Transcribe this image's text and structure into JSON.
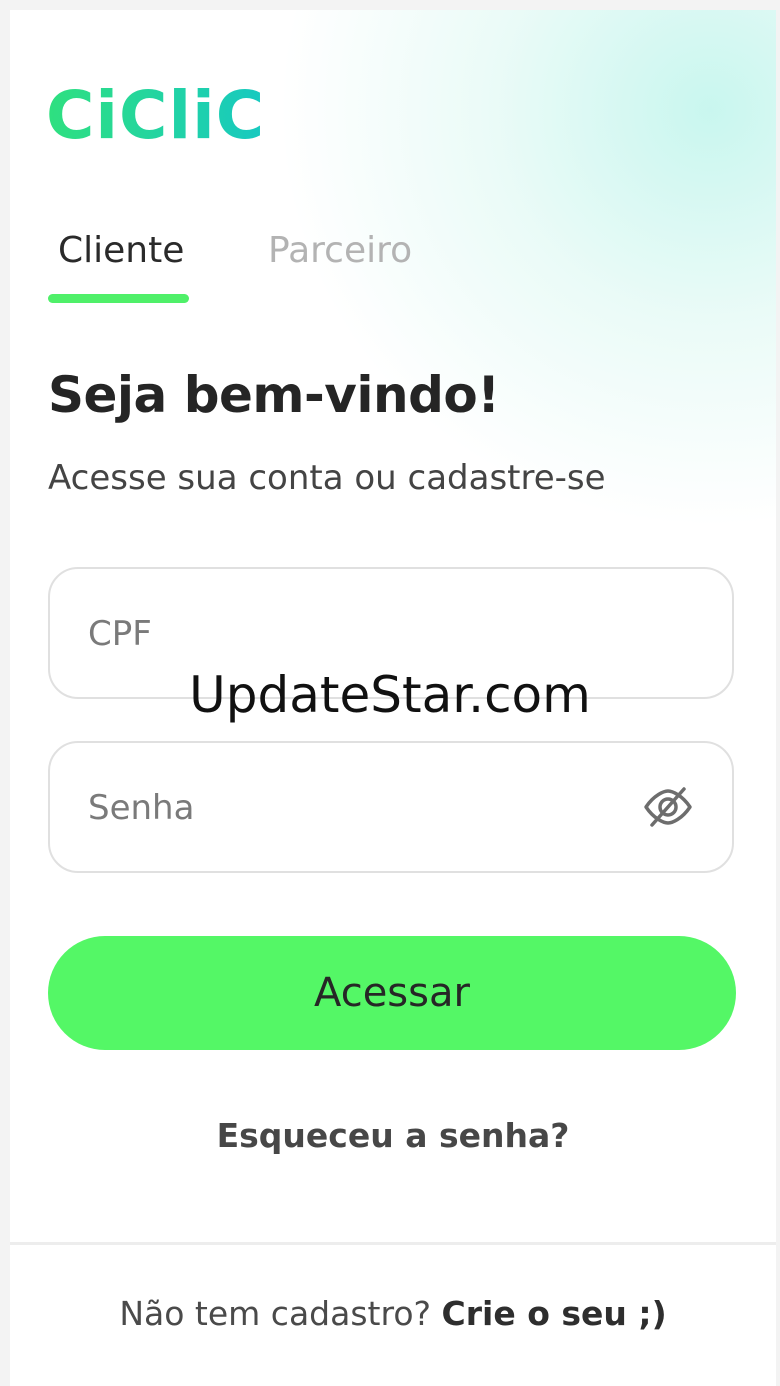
{
  "app": {
    "logo_text": "CiCliC",
    "logo_gradient": [
      "#2fe07f",
      "#17c9c1"
    ]
  },
  "tabs": [
    {
      "label": "Cliente",
      "active": true
    },
    {
      "label": "Parceiro",
      "active": false
    }
  ],
  "welcome": {
    "title": "Seja bem-vindo!",
    "subtitle": "Acesse sua conta ou cadastre-se"
  },
  "form": {
    "cpf_placeholder": "CPF",
    "cpf_value": "",
    "password_placeholder": "Senha",
    "password_value": "",
    "toggle_icon": "eye-off-icon",
    "submit_label": "Acessar",
    "forgot_label": "Esqueceu a senha?"
  },
  "footer": {
    "question": "Não tem cadastro?",
    "link": "Crie o seu ;)"
  },
  "watermark": "UpdateStar.com",
  "colors": {
    "accent_green": "#54f766",
    "tab_indicator": "#4ff069",
    "glow": "#c6f6ee"
  }
}
